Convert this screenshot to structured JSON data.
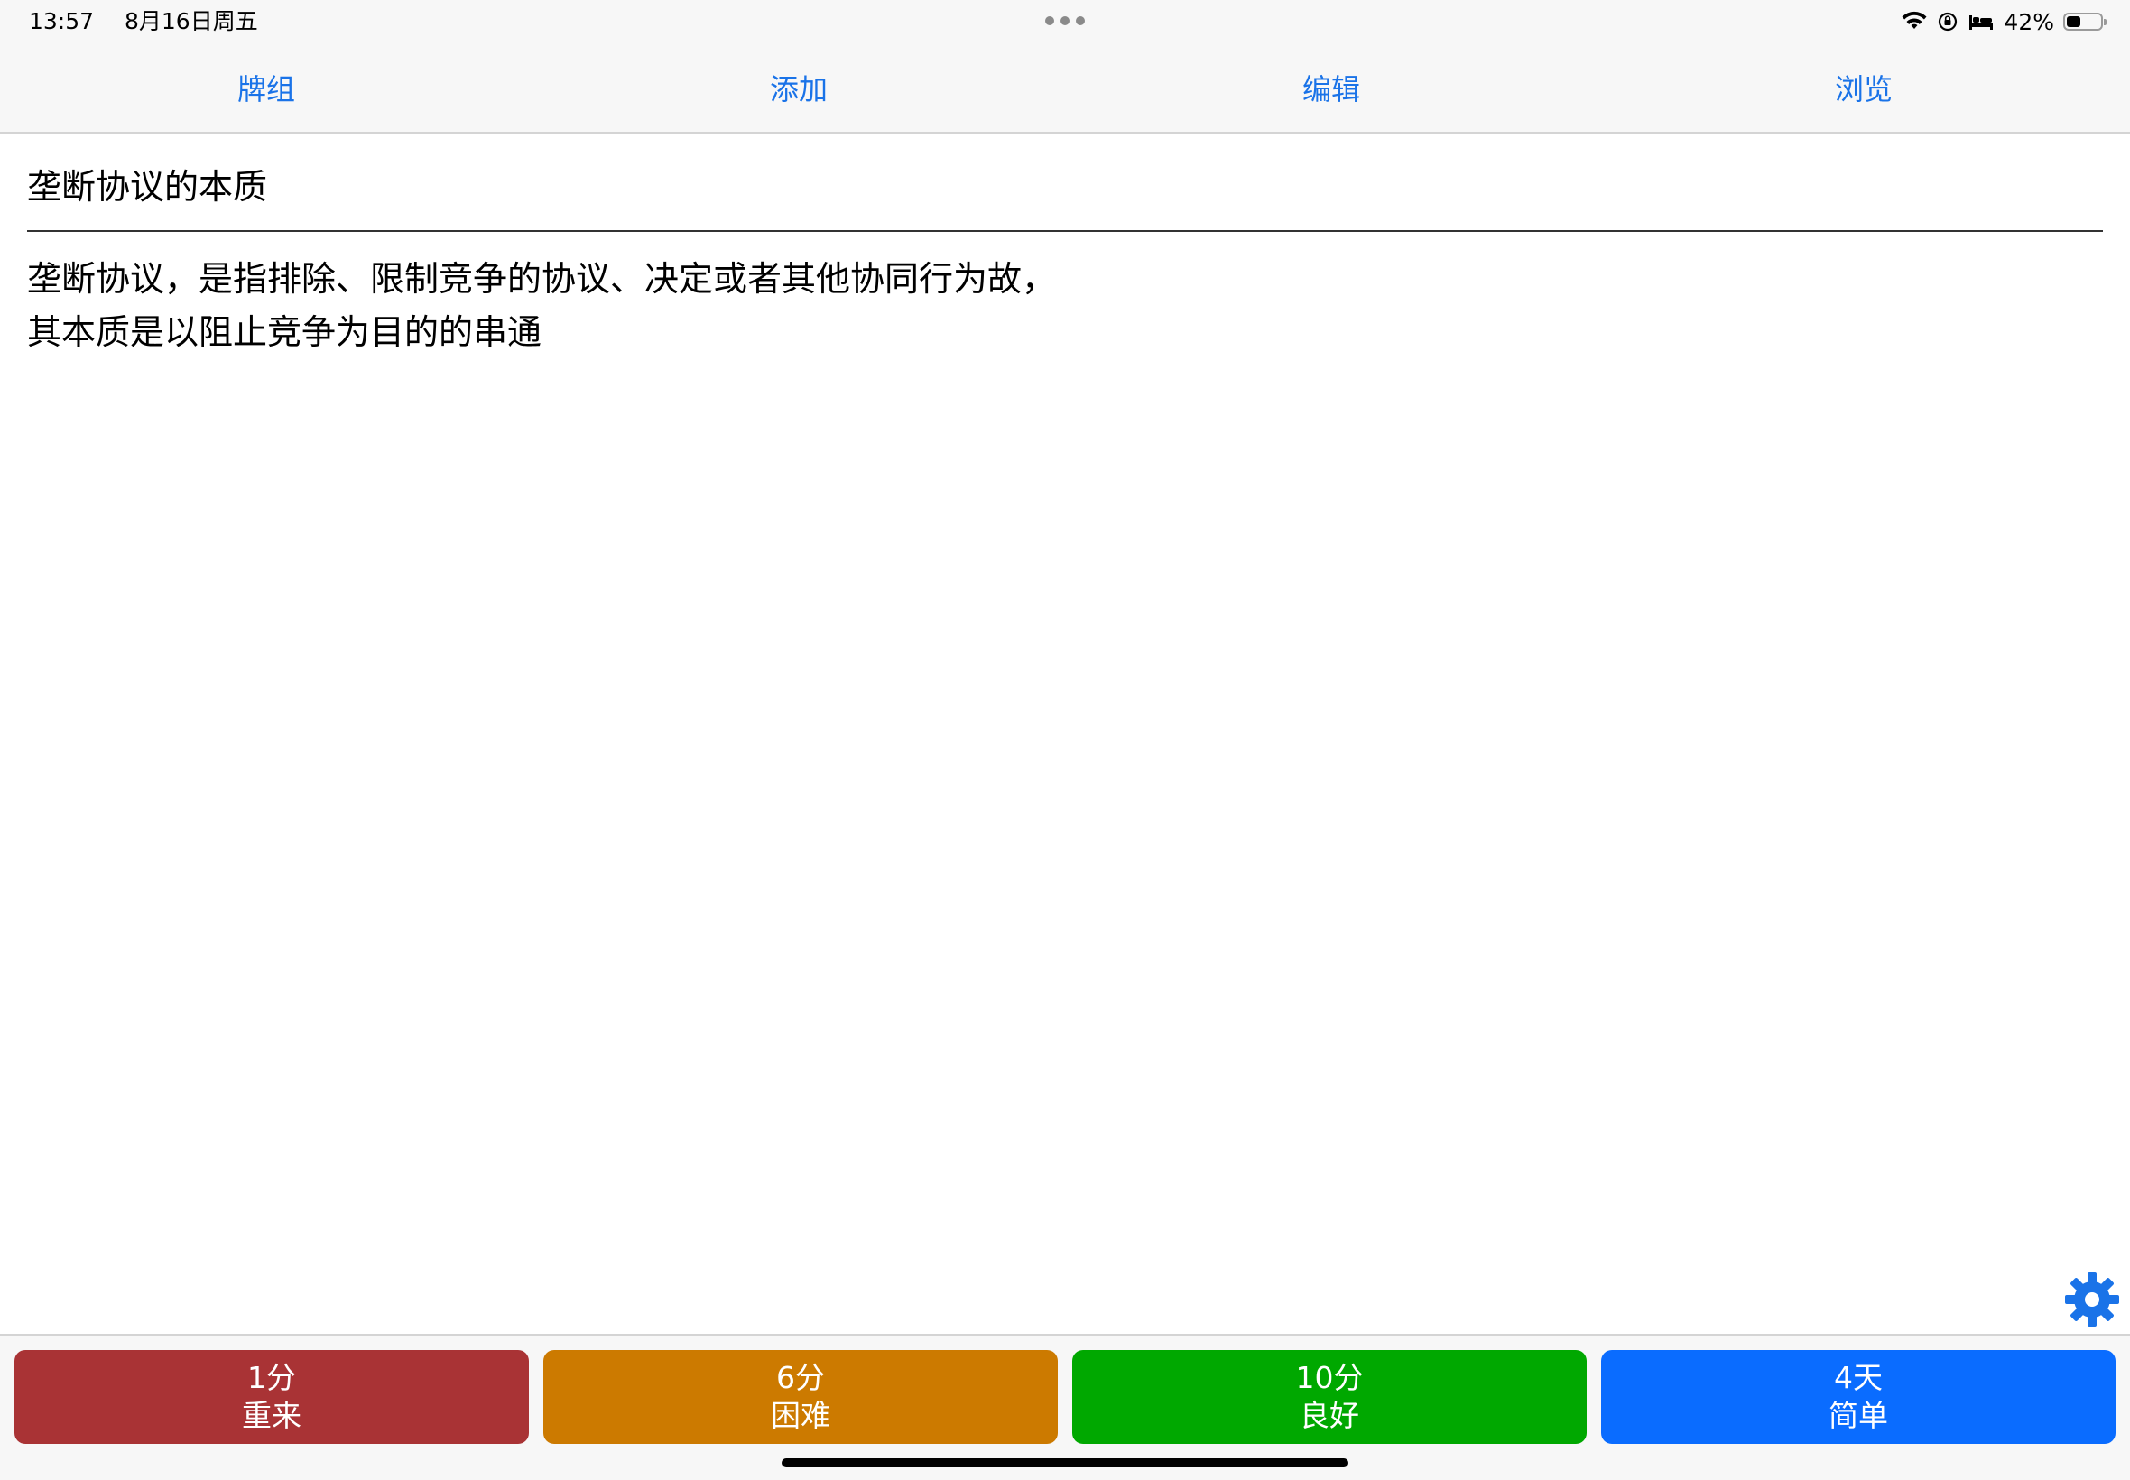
{
  "status": {
    "time": "13:57",
    "date": "8月16日周五",
    "battery_text": "42%",
    "battery_level": 0.42
  },
  "nav": {
    "decks": "牌组",
    "add": "添加",
    "edit": "编辑",
    "browse": "浏览"
  },
  "card": {
    "front": "垄断协议的本质",
    "back": "垄断协议，是指排除、限制竞争的协议、决定或者其他协同行为故，其本质是以阻止竞争为目的的串通"
  },
  "answers": [
    {
      "interval": "1分",
      "label": "重来",
      "color": "#a93335"
    },
    {
      "interval": "6分",
      "label": "困难",
      "color": "#cc7a00"
    },
    {
      "interval": "10分",
      "label": "良好",
      "color": "#00a800"
    },
    {
      "interval": "4天",
      "label": "简单",
      "color": "#0a6cff"
    }
  ],
  "colors": {
    "accent": "#1a73e8",
    "gear": "#1a73e8"
  },
  "icons": [
    "wifi-icon",
    "orientation-lock-icon",
    "sleep-focus-icon",
    "battery-icon",
    "gear-icon"
  ]
}
